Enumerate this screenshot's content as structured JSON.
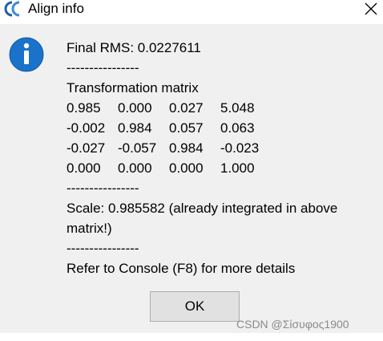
{
  "window": {
    "title": "Align info",
    "app_icon": "cloudcompare-logo-icon",
    "close_icon": "close-icon"
  },
  "message": {
    "icon": "info-icon",
    "final_rms": "Final RMS: 0.0227611",
    "separator": "----------------",
    "matrix_title": "Transformation matrix",
    "matrix": [
      [
        "0.985",
        "0.000",
        "0.027",
        "5.048"
      ],
      [
        "-0.002",
        "0.984",
        "0.057",
        "0.063"
      ],
      [
        "-0.027",
        "-0.057",
        "0.984",
        "-0.023"
      ],
      [
        "0.000",
        "0.000",
        "0.000",
        "1.000"
      ]
    ],
    "scale": "Scale: 0.985582 (already integrated in above matrix!)",
    "console_hint": "Refer to Console (F8) for more details"
  },
  "buttons": {
    "ok_label": "OK"
  },
  "watermark": "CSDN @Σίσυφος1900",
  "colors": {
    "info_blue": "#1a73c8",
    "dialog_bg": "#f0f0f0",
    "button_bg": "#e1e1e1",
    "button_border": "#adadad"
  }
}
